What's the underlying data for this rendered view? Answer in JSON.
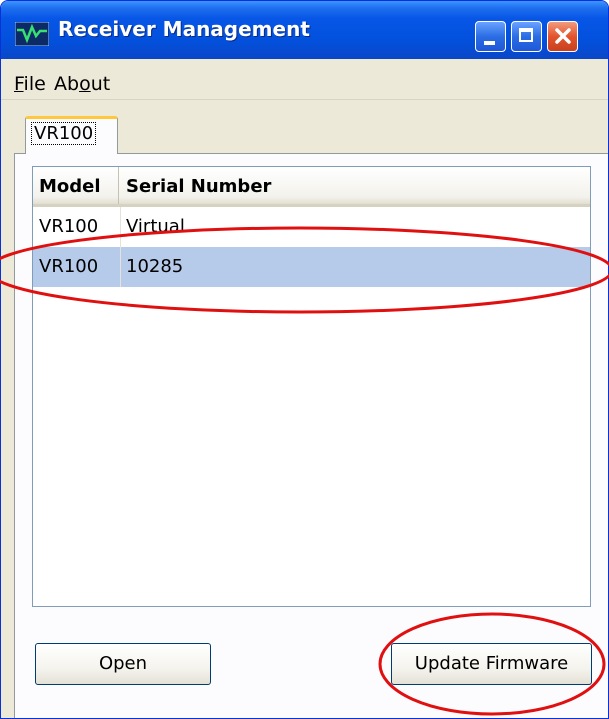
{
  "window": {
    "title": "Receiver Management",
    "icons": {
      "app": "waveform-app-icon",
      "minimize": "minimize-icon",
      "maximize": "maximize-icon",
      "close": "close-icon"
    }
  },
  "menu": {
    "file": {
      "mnemonic": "F",
      "rest": "ile"
    },
    "about": {
      "pre": "Ab",
      "mnemonic": "o",
      "rest": "ut"
    }
  },
  "tabs": [
    {
      "label": "VR100",
      "selected": true
    }
  ],
  "list": {
    "columns": [
      "Model",
      "Serial Number"
    ],
    "rows": [
      {
        "model": "VR100",
        "serial": "Virtual",
        "selected": false
      },
      {
        "model": "VR100",
        "serial": "10285",
        "selected": true
      }
    ]
  },
  "buttons": {
    "open": "Open",
    "update_firmware": "Update Firmware"
  },
  "colors": {
    "title_bar": "#0553e3",
    "selection": "#b6cae9",
    "annotation": "#e01010"
  }
}
